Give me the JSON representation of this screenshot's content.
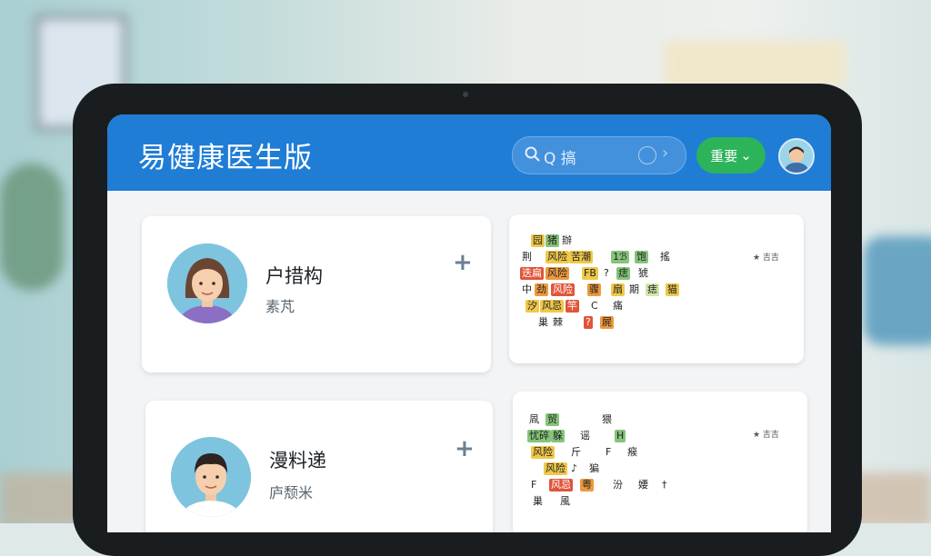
{
  "app": {
    "title": "易健康医生版"
  },
  "search": {
    "icon": "search-icon",
    "text": "Q 搞"
  },
  "header": {
    "menu_label": "重要",
    "menu_chevron": "⌄"
  },
  "patients": [
    {
      "name": "户措构",
      "sub": "素芃",
      "add_label": "+"
    },
    {
      "name": "漫料递",
      "sub": "庐颓米",
      "add_label": "+"
    }
  ],
  "grid_cards": [
    {
      "badge": "★ 吉吉",
      "cells": [
        {
          "t": "园",
          "c": "y"
        },
        {
          "t": "猪",
          "c": "g"
        },
        {
          "t": "辦",
          "c": "w"
        },
        {
          "t": "荆",
          "c": "w"
        },
        {
          "t": "风险",
          "c": "y"
        },
        {
          "t": "苦潮",
          "c": "y"
        },
        {
          "t": "1ℬ",
          "c": "g"
        },
        {
          "t": "饱",
          "c": "g"
        },
        {
          "t": "搖",
          "c": "w"
        },
        {
          "t": "迭扁",
          "c": "r"
        },
        {
          "t": "风险",
          "c": "o"
        },
        {
          "t": "FB",
          "c": "y"
        },
        {
          "t": "?",
          "c": "w"
        },
        {
          "t": "痣",
          "c": "g"
        },
        {
          "t": "猇",
          "c": "w"
        },
        {
          "t": "中",
          "c": "w"
        },
        {
          "t": "劲",
          "c": "o"
        },
        {
          "t": "风险",
          "c": "r"
        },
        {
          "t": "骤",
          "c": "o"
        },
        {
          "t": "扇",
          "c": "y"
        },
        {
          "t": "期",
          "c": "w"
        },
        {
          "t": "痣",
          "c": "l"
        },
        {
          "t": "猫",
          "c": "y"
        },
        {
          "t": "汐",
          "c": "y"
        },
        {
          "t": "风忌",
          "c": "y"
        },
        {
          "t": "竿",
          "c": "r"
        },
        {
          "t": "C",
          "c": "w"
        },
        {
          "t": "痛",
          "c": "w"
        },
        {
          "t": "巢",
          "c": "w"
        },
        {
          "t": "棘",
          "c": "w"
        },
        {
          "t": "?",
          "c": "r"
        },
        {
          "t": "屍",
          "c": "o"
        }
      ]
    },
    {
      "badge": "★ 吉吉",
      "cells": [
        {
          "t": "凮",
          "c": "w"
        },
        {
          "t": "贸",
          "c": "g"
        },
        {
          "t": "猥",
          "c": "w"
        },
        {
          "t": "忧碎",
          "c": "g"
        },
        {
          "t": "躲",
          "c": "g"
        },
        {
          "t": "谣",
          "c": "w"
        },
        {
          "t": "H",
          "c": "g"
        },
        {
          "t": "风险",
          "c": "y"
        },
        {
          "t": "斤",
          "c": "w"
        },
        {
          "t": "F",
          "c": "w"
        },
        {
          "t": "瘊",
          "c": "w"
        },
        {
          "t": "风险",
          "c": "y"
        },
        {
          "t": "♪",
          "c": "w"
        },
        {
          "t": "猵",
          "c": "w"
        },
        {
          "t": "F",
          "c": "w"
        },
        {
          "t": "风忌",
          "c": "r"
        },
        {
          "t": "粤",
          "c": "o"
        },
        {
          "t": "汾",
          "c": "w"
        },
        {
          "t": "婹",
          "c": "w"
        },
        {
          "t": "†",
          "c": "w"
        },
        {
          "t": "巢",
          "c": "w"
        },
        {
          "t": "風",
          "c": "w"
        }
      ]
    }
  ]
}
